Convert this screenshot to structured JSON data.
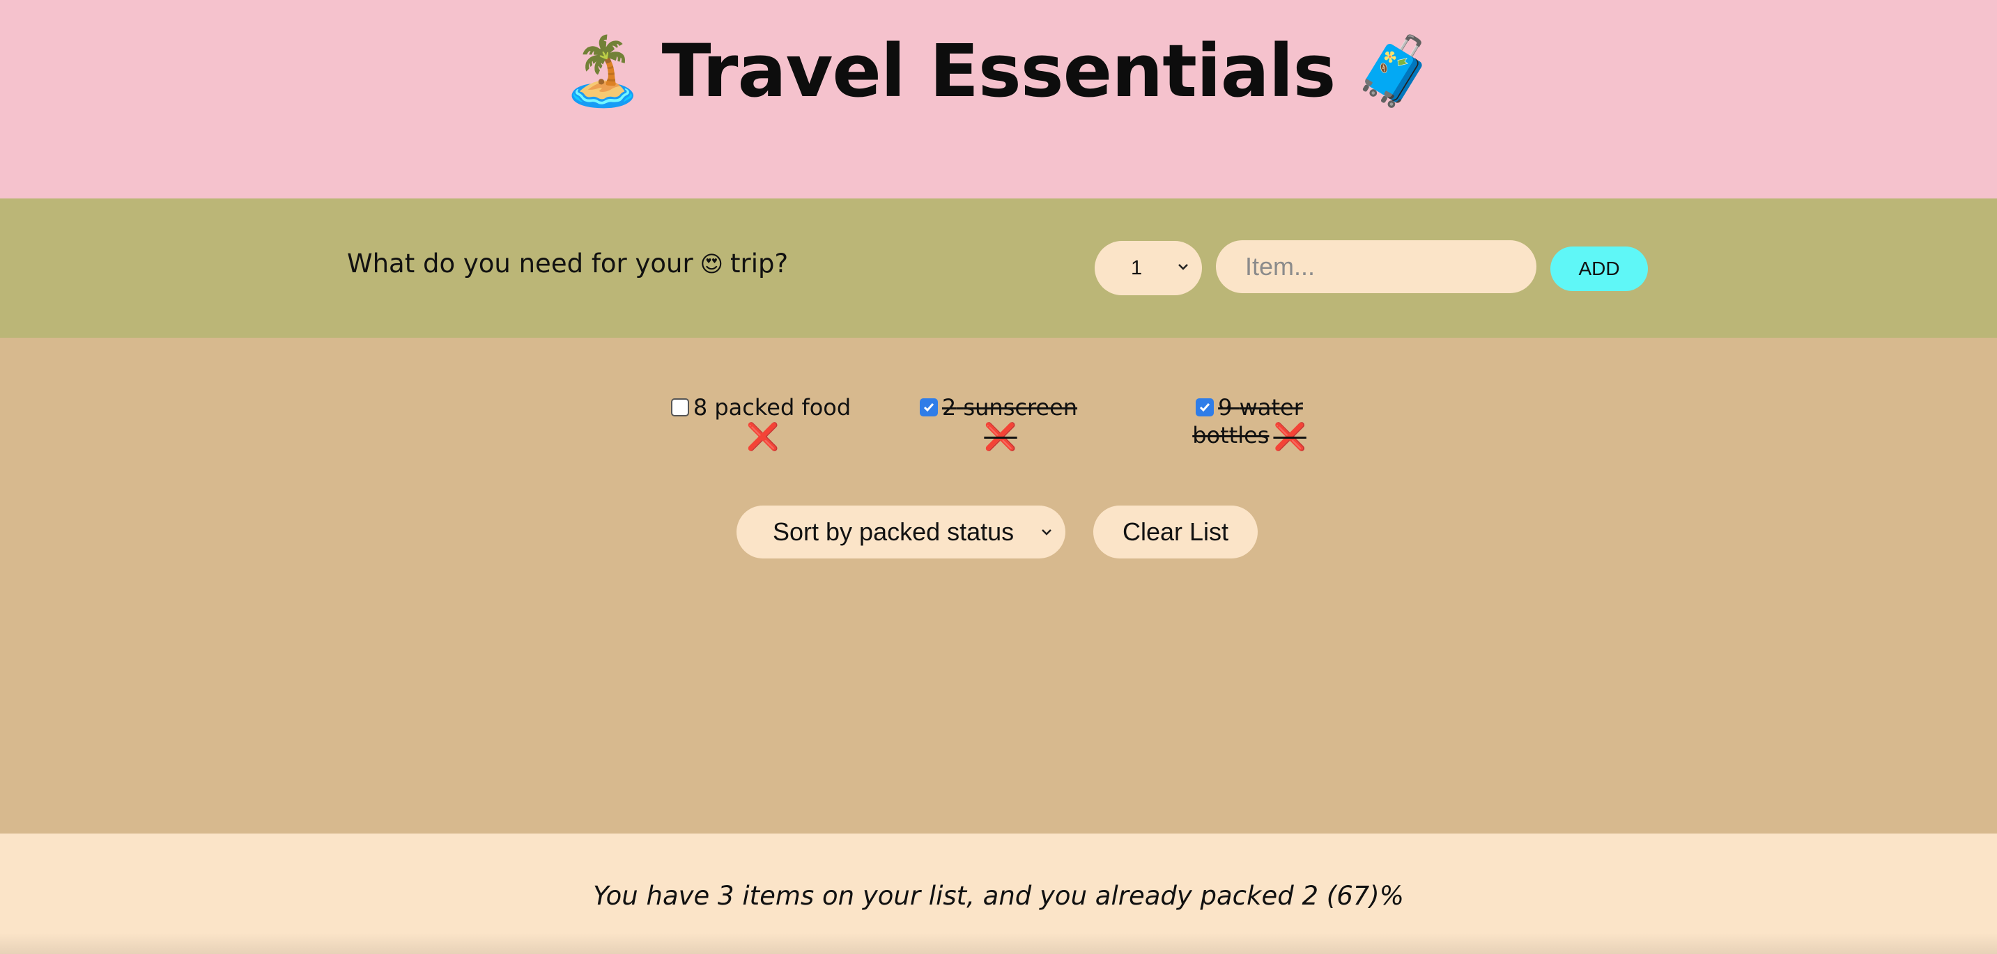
{
  "header": {
    "title": "Travel Essentials",
    "emoji_left": "🏝️",
    "emoji_right": "🧳"
  },
  "form": {
    "question_prefix": "What do you need for your",
    "question_emoji": "😍",
    "question_suffix": "trip?",
    "quantity_value": "1",
    "item_placeholder": "Item...",
    "item_value": "",
    "add_label": "ADD"
  },
  "items": [
    {
      "quantity": "8",
      "description": "packed food",
      "packed": false,
      "delete_icon": "❌"
    },
    {
      "quantity": "2",
      "description": "sunscreen",
      "packed": true,
      "delete_icon": "❌"
    },
    {
      "quantity": "9",
      "description": "water bottles",
      "packed": true,
      "delete_icon": "❌"
    }
  ],
  "actions": {
    "sort_value": "Sort by packed status",
    "clear_label": "Clear List"
  },
  "stats": {
    "text": "You have 3 items on your list, and you already packed 2 (67)%"
  },
  "colors": {
    "header_bg": "#f5c2cd",
    "form_bg": "#bbb677",
    "list_bg": "#d7b98e",
    "stats_bg": "#fbe4c8",
    "add_button": "#5ff7f7",
    "checkbox_checked": "#2f7de8",
    "delete_red": "#d92b1c"
  }
}
